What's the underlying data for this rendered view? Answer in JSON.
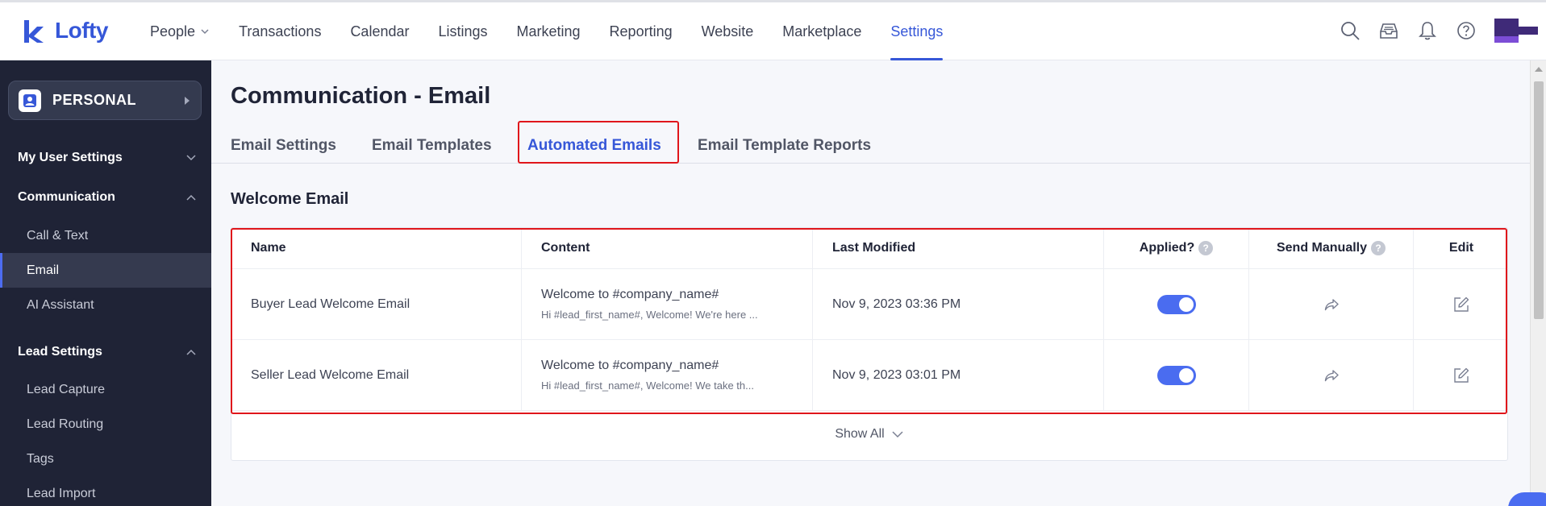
{
  "brand": {
    "name": "Lofty",
    "color": "#3657d8"
  },
  "nav": {
    "items": [
      {
        "label": "People",
        "has_dropdown": true
      },
      {
        "label": "Transactions"
      },
      {
        "label": "Calendar"
      },
      {
        "label": "Listings"
      },
      {
        "label": "Marketing"
      },
      {
        "label": "Reporting"
      },
      {
        "label": "Website"
      },
      {
        "label": "Marketplace"
      },
      {
        "label": "Settings",
        "active": true
      }
    ],
    "icons": [
      "search-icon",
      "inbox-icon",
      "bell-icon",
      "help-icon"
    ]
  },
  "sidebar": {
    "scope_label": "PERSONAL",
    "sections": [
      {
        "title": "My User Settings",
        "expanded": false,
        "items": []
      },
      {
        "title": "Communication",
        "expanded": true,
        "items": [
          {
            "label": "Call & Text"
          },
          {
            "label": "Email",
            "active": true
          },
          {
            "label": "AI Assistant"
          }
        ]
      },
      {
        "title": "Lead Settings",
        "expanded": true,
        "items": [
          {
            "label": "Lead Capture"
          },
          {
            "label": "Lead Routing"
          },
          {
            "label": "Tags"
          },
          {
            "label": "Lead Import"
          }
        ]
      }
    ]
  },
  "main": {
    "title": "Communication - Email",
    "tabs": [
      {
        "label": "Email Settings"
      },
      {
        "label": "Email Templates"
      },
      {
        "label": "Automated Emails",
        "active": true
      },
      {
        "label": "Email Template Reports"
      }
    ],
    "section_title": "Welcome Email",
    "table": {
      "headers": {
        "name": "Name",
        "content": "Content",
        "last_modified": "Last Modified",
        "applied": "Applied?",
        "send_manually": "Send Manually",
        "edit": "Edit"
      },
      "help_glyph": "?",
      "rows": [
        {
          "name": "Buyer Lead Welcome Email",
          "subject": "Welcome to #company_name#",
          "preview": "Hi #lead_first_name#, Welcome! We're here ...",
          "last_modified": "Nov 9, 2023 03:36 PM",
          "applied": true
        },
        {
          "name": "Seller Lead Welcome Email",
          "subject": "Welcome to #company_name#",
          "preview": "Hi #lead_first_name#, Welcome! We take th...",
          "last_modified": "Nov 9, 2023 03:01 PM",
          "applied": true
        }
      ],
      "show_all_label": "Show All"
    }
  },
  "colors": {
    "accent": "#3657d8",
    "toggle_on": "#4a6cf0",
    "highlight": "#e0161b",
    "sidebar_bg": "#1f2336"
  }
}
